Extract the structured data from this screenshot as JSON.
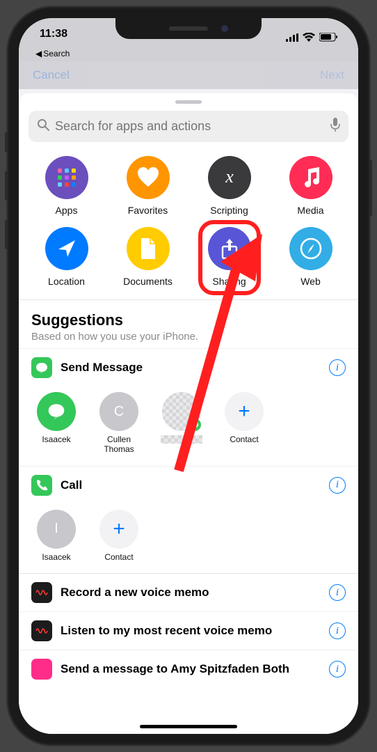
{
  "status": {
    "time": "11:38",
    "back_label": "Search"
  },
  "nav": {
    "cancel": "Cancel",
    "next": "Next"
  },
  "search": {
    "placeholder": "Search for apps and actions"
  },
  "categories": [
    {
      "label": "Apps",
      "color": "#6b4fbd",
      "icon": "apps"
    },
    {
      "label": "Favorites",
      "color": "#ff9500",
      "icon": "heart"
    },
    {
      "label": "Scripting",
      "color": "#3a3a3c",
      "icon": "script"
    },
    {
      "label": "Media",
      "color": "#ff2d55",
      "icon": "music"
    },
    {
      "label": "Location",
      "color": "#007aff",
      "icon": "location"
    },
    {
      "label": "Documents",
      "color": "#ffcc00",
      "icon": "document"
    },
    {
      "label": "Sharing",
      "color": "#5856d6",
      "icon": "share",
      "highlighted": true
    },
    {
      "label": "Web",
      "color": "#32ade6",
      "icon": "compass"
    }
  ],
  "suggestions": {
    "title": "Suggestions",
    "subtitle": "Based on how you use your iPhone."
  },
  "send_message": {
    "title": "Send Message",
    "icon_bg": "#34c759",
    "contacts": [
      {
        "name": "Isaacek",
        "type": "msg"
      },
      {
        "name": "Cullen Thomas",
        "type": "initial",
        "initial": "C"
      },
      {
        "name": "",
        "type": "blurred"
      },
      {
        "name": "Contact",
        "type": "add"
      }
    ]
  },
  "call": {
    "title": "Call",
    "icon_bg": "#34c759",
    "contacts": [
      {
        "name": "Isaacek",
        "type": "initial",
        "initial": "I"
      },
      {
        "name": "Contact",
        "type": "add"
      }
    ]
  },
  "more_suggestions": [
    {
      "title": "Record a new voice memo",
      "icon_bg": "#1c1c1e"
    },
    {
      "title": "Listen to my most recent voice memo",
      "icon_bg": "#1c1c1e"
    },
    {
      "title": "Send a message to Amy Spitzfaden Both",
      "icon_bg": "#ff2d89"
    }
  ]
}
